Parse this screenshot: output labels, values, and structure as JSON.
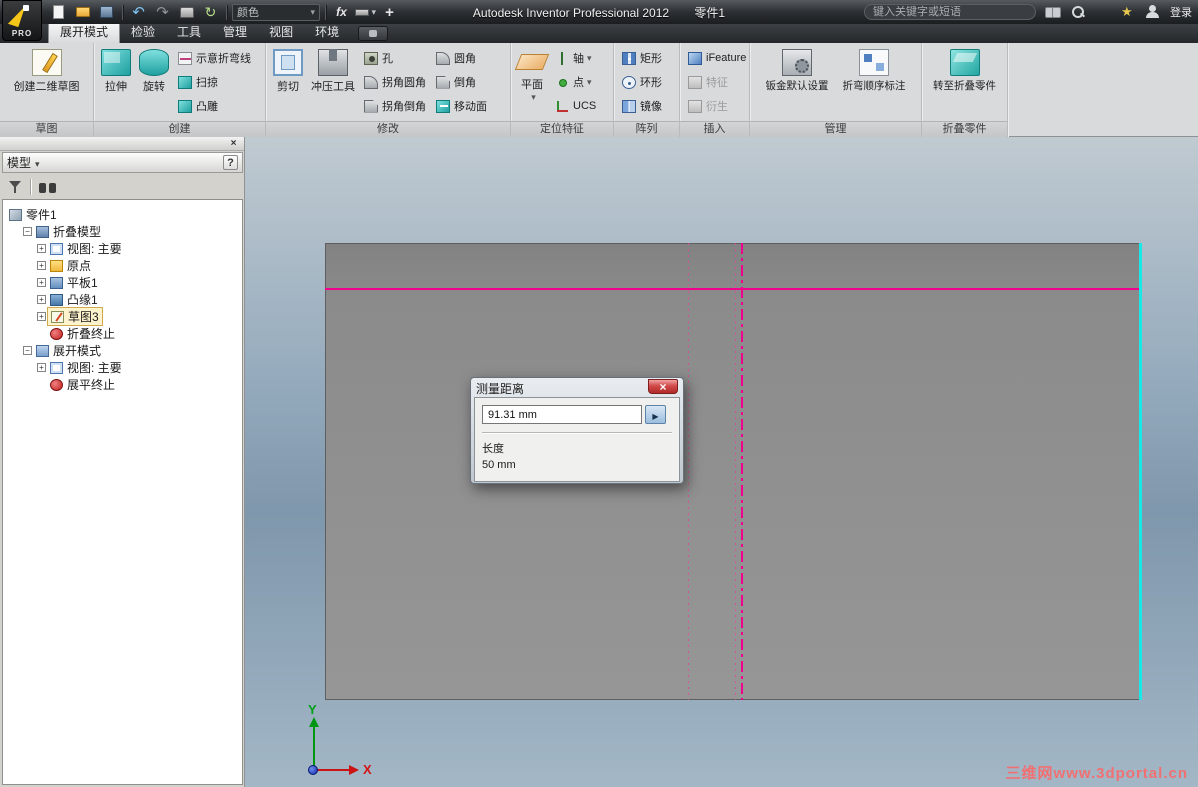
{
  "titlebar": {
    "logo_text": "PRO",
    "app_title": "Autodesk Inventor Professional 2012",
    "doc_name": "零件1",
    "color_combo": "颜色",
    "fx_label": "fx",
    "search_placeholder": "键入关键字或短语",
    "signin_label": "登录"
  },
  "tabs": [
    {
      "label": "展开模式"
    },
    {
      "label": "检验"
    },
    {
      "label": "工具"
    },
    {
      "label": "管理"
    },
    {
      "label": "视图"
    },
    {
      "label": "环境"
    }
  ],
  "ribbon": {
    "sketch": {
      "label": "草图",
      "create_sketch": "创建二维草图"
    },
    "create": {
      "label": "创建",
      "extrude": "拉伸",
      "revolve": "旋转",
      "bend_line": "示意折弯线",
      "sweep": "扫掠",
      "emboss": "凸雕"
    },
    "modify": {
      "label": "修改",
      "cut": "剪切",
      "punch_tool": "冲压工具",
      "hole": "孔",
      "corner_round": "拐角圆角",
      "corner_chamfer": "拐角倒角",
      "fillet": "圆角",
      "chamfer": "倒角",
      "move_face": "移动面"
    },
    "work_features": {
      "label": "定位特征",
      "plane": "平面",
      "axis": "轴",
      "point": "点",
      "ucs": "UCS"
    },
    "pattern": {
      "label": "阵列",
      "rectangular": "矩形",
      "circular": "环形",
      "mirror": "镜像"
    },
    "insert": {
      "label": "插入",
      "ifeature": "iFeature",
      "feature": "特征",
      "derive": "衍生"
    },
    "manage": {
      "label": "管理",
      "sheet_metal_defaults": "钣金默认设置",
      "bend_order": "折弯顺序标注"
    },
    "folded_part": {
      "label": "折叠零件",
      "go_to_folded": "转至折叠零件"
    }
  },
  "browser": {
    "title": "模型",
    "help_label": "?",
    "tree": [
      {
        "label": "零件1"
      },
      {
        "label": "折叠模型"
      },
      {
        "label": "视图: 主要"
      },
      {
        "label": "原点"
      },
      {
        "label": "平板1"
      },
      {
        "label": "凸缘1"
      },
      {
        "label": "草图3"
      },
      {
        "label": "折叠终止"
      },
      {
        "label": "展开模式"
      },
      {
        "label": "视图: 主要"
      },
      {
        "label": "展平终止"
      }
    ]
  },
  "dialog": {
    "title": "测量距离",
    "value": "91.31 mm",
    "section_label": "长度",
    "section_value": "50 mm"
  },
  "viewport": {
    "axis_x": "X",
    "axis_y": "Y",
    "watermark": "三维网www.3dportal.cn"
  }
}
